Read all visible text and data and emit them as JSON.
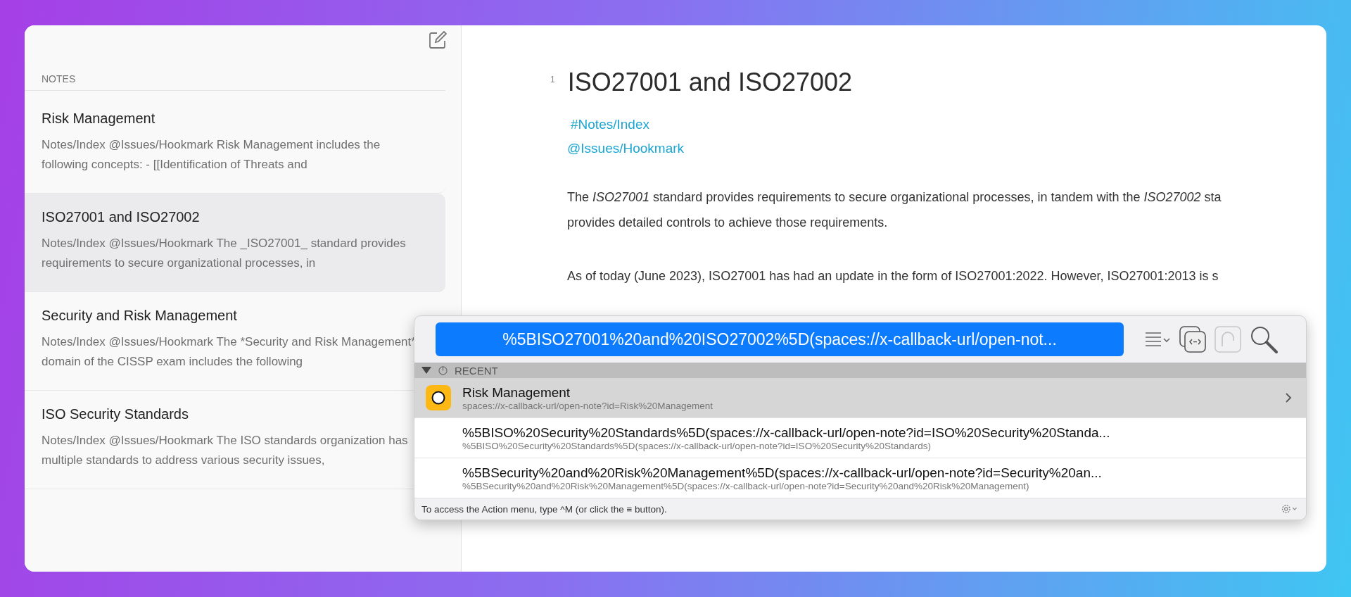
{
  "sidebar": {
    "section": "NOTES",
    "notes": [
      {
        "title": "Risk Management",
        "preview": "Notes/Index @Issues/Hookmark Risk Management includes the following concepts: - [[Identification of Threats and",
        "selected": false
      },
      {
        "title": "ISO27001 and ISO27002",
        "preview": "Notes/Index @Issues/Hookmark The _ISO27001_ standard provides requirements to secure organizational processes, in",
        "selected": true
      },
      {
        "title": "Security and Risk Management",
        "preview": "Notes/Index @Issues/Hookmark The *Security and Risk Management* domain of the CISSP exam includes the following",
        "selected": false
      },
      {
        "title": "ISO Security Standards",
        "preview": "Notes/Index @Issues/Hookmark The ISO standards organization has multiple standards to address various security issues,",
        "selected": false
      }
    ]
  },
  "editor": {
    "line_number": "1",
    "title": "ISO27001 and ISO27002",
    "tags": [
      "#Notes/Index",
      "@Issues/Hookmark"
    ],
    "paragraphs": [
      {
        "lines": [
          "The *ISO27001* standard provides requirements to secure organizational processes, in tandem with the *ISO27002* sta",
          "provides detailed controls to achieve those requirements."
        ]
      },
      {
        "lines": [
          "As of today (June 2023), ISO27001 has had an update in the form of ISO27001:2022. However, ISO27001:2013 is s"
        ]
      }
    ]
  },
  "popup": {
    "field_value": "%5BISO27001%20and%20ISO27002%5D(spaces://x-callback-url/open-not...",
    "section": "RECENT",
    "items": [
      {
        "kind": "app",
        "title": "Risk Management",
        "subtitle": "spaces://x-callback-url/open-note?id=Risk%20Management",
        "selected": true
      },
      {
        "kind": "link",
        "title": "%5BISO%20Security%20Standards%5D(spaces://x-callback-url/open-note?id=ISO%20Security%20Standa...",
        "subtitle": "%5BISO%20Security%20Standards%5D(spaces://x-callback-url/open-note?id=ISO%20Security%20Standards)",
        "selected": false
      },
      {
        "kind": "link",
        "title": "%5BSecurity%20and%20Risk%20Management%5D(spaces://x-callback-url/open-note?id=Security%20an...",
        "subtitle": "%5BSecurity%20and%20Risk%20Management%5D(spaces://x-callback-url/open-note?id=Security%20and%20Risk%20Management)",
        "selected": false
      }
    ],
    "footer": "To access the Action menu, type ^M (or click the ≡ button)."
  }
}
